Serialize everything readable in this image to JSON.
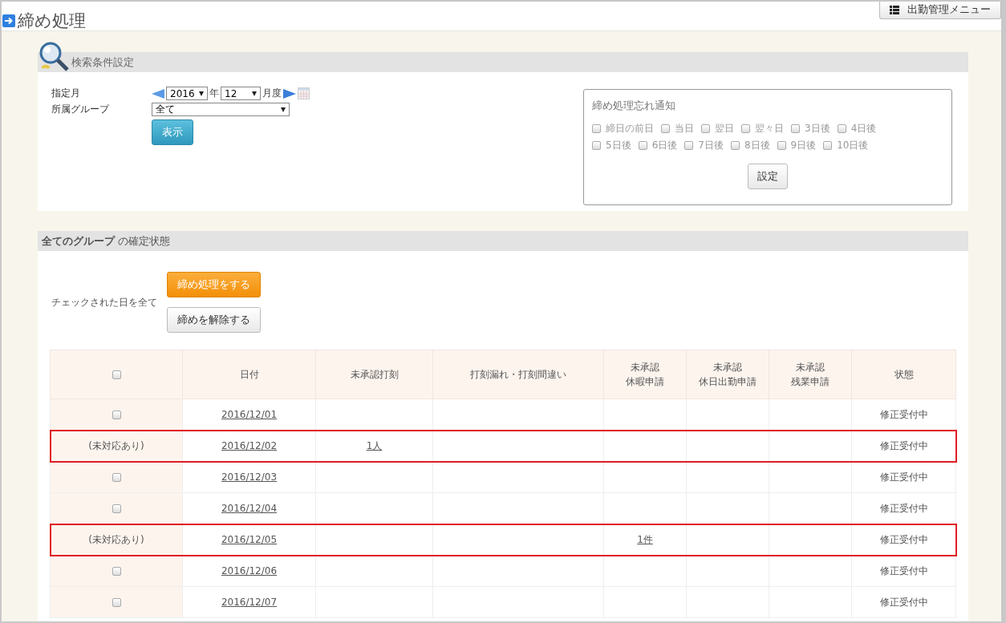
{
  "page": {
    "title": "締め処理",
    "menu_button": "出勤管理メニュー"
  },
  "search": {
    "title": "検索条件設定",
    "month_label": "指定月",
    "year": "2016",
    "year_unit": "年",
    "month": "12",
    "month_unit": "月度",
    "group_label": "所属グループ",
    "group": "全て",
    "show_button": "表示"
  },
  "notice": {
    "title": "締め処理忘れ通知",
    "options": [
      {
        "label": "締日の前日",
        "checked": false
      },
      {
        "label": "当日",
        "checked": false
      },
      {
        "label": "翌日",
        "checked": false
      },
      {
        "label": "翌々日",
        "checked": false
      },
      {
        "label": "3日後",
        "checked": false
      },
      {
        "label": "4日後",
        "checked": false
      },
      {
        "label": "5日後",
        "checked": false
      },
      {
        "label": "6日後",
        "checked": false
      },
      {
        "label": "7日後",
        "checked": false
      },
      {
        "label": "8日後",
        "checked": false
      },
      {
        "label": "9日後",
        "checked": false
      },
      {
        "label": "10日後",
        "checked": false
      }
    ],
    "button": "設定"
  },
  "status": {
    "title": "**全てのグループ** の確定状態",
    "bulk_label": "チェックされた日を全て",
    "close_button": "締め処理をする",
    "release_button": "締めを解除する",
    "table": {
      "select_all_checked": false,
      "columns": [
        {
          "label": "日付"
        },
        {
          "label": "未承認打刻"
        },
        {
          "label": "打刻漏れ・打刻間違い"
        },
        {
          "overline": "未承認",
          "label": "休暇申請"
        },
        {
          "overline": "未承認",
          "label": "休日出勤申請"
        },
        {
          "overline": "未承認",
          "label": "残業申請"
        },
        {
          "label": "状態"
        }
      ],
      "rows": [
        {
          "kind": "checkbox",
          "checked": false,
          "highlighted": false,
          "cells": [
            "2016/12/01",
            "",
            "",
            "",
            "",
            "",
            "修正受付中"
          ]
        },
        {
          "kind": "pending",
          "label": "(未対応あり)",
          "highlighted": true,
          "cells": [
            "2016/12/02",
            "1人",
            "",
            "",
            "",
            "",
            "修正受付中"
          ]
        },
        {
          "kind": "checkbox",
          "checked": false,
          "highlighted": false,
          "cells": [
            "2016/12/03",
            "",
            "",
            "",
            "",
            "",
            "修正受付中"
          ]
        },
        {
          "kind": "checkbox",
          "checked": false,
          "highlighted": false,
          "cells": [
            "2016/12/04",
            "",
            "",
            "",
            "",
            "",
            "修正受付中"
          ]
        },
        {
          "kind": "pending",
          "label": "(未対応あり)",
          "highlighted": true,
          "cells": [
            "2016/12/05",
            "",
            "",
            "1件",
            "",
            "",
            "修正受付中"
          ]
        },
        {
          "kind": "checkbox",
          "checked": false,
          "highlighted": false,
          "cells": [
            "2016/12/06",
            "",
            "",
            "",
            "",
            "",
            "修正受付中"
          ]
        },
        {
          "kind": "checkbox",
          "checked": false,
          "highlighted": false,
          "cells": [
            "2016/12/07",
            "",
            "",
            "",
            "",
            "",
            "修正受付中"
          ]
        }
      ]
    }
  }
}
